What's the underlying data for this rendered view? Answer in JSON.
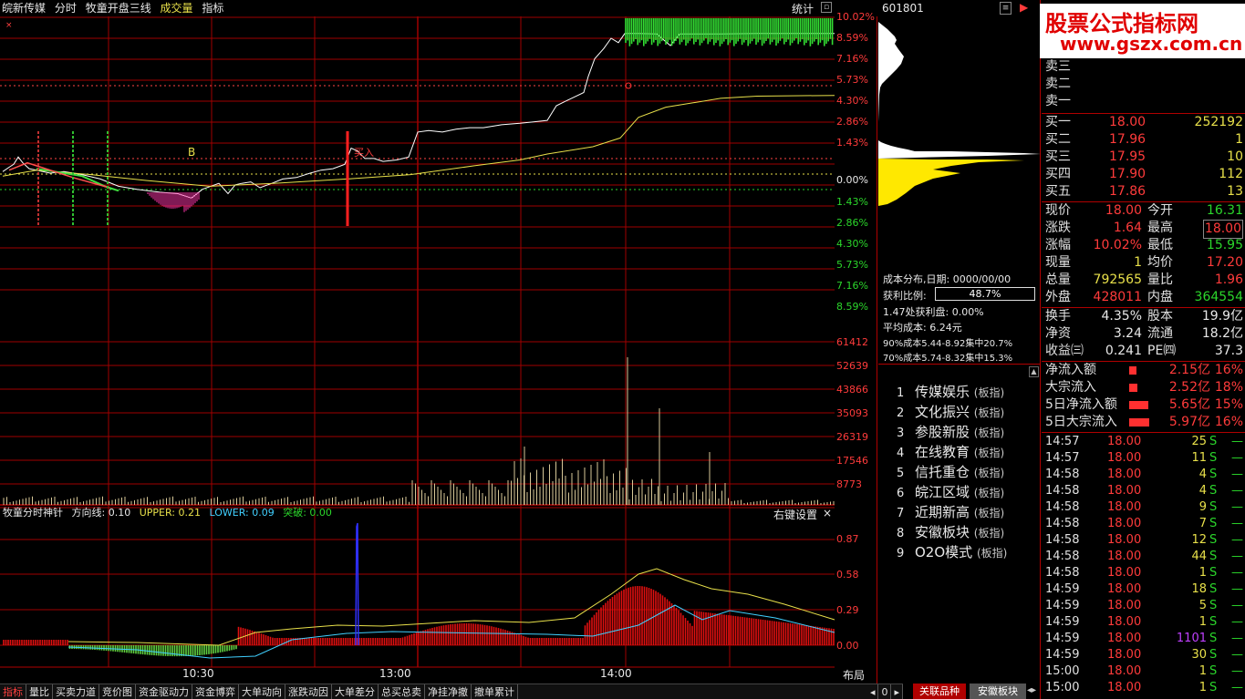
{
  "topbar": {
    "stock_name": "皖新传媒",
    "mode": "分时",
    "formula": "牧童开盘三线",
    "vol_label": "成交量",
    "indicator": "指标",
    "stats": "统计"
  },
  "price_axis": {
    "up_labels": [
      "10.02%",
      "8.59%",
      "7.16%",
      "5.73%",
      "4.30%",
      "2.86%",
      "1.43%"
    ],
    "zero": "0.00%",
    "down_labels": [
      "1.43%",
      "2.86%",
      "4.30%",
      "5.73%",
      "7.16%",
      "8.59%"
    ]
  },
  "volume_axis": [
    "61412",
    "52639",
    "43866",
    "35093",
    "26319",
    "17546",
    "8773"
  ],
  "indicator_axis": [
    "0.87",
    "0.58",
    "0.29",
    "0.00"
  ],
  "time_axis": [
    "10:30",
    "13:00",
    "14:00"
  ],
  "chart_marks": {
    "b_label": "B",
    "buy_label": "买入"
  },
  "indicator_bar": {
    "name": "牧童分时神针",
    "direction": "方向线: 0.10",
    "upper": "UPPER: 0.21",
    "lower": "LOWER: 0.09",
    "breakout": "突破: 0.00",
    "settings": "右键设置",
    "close": "×"
  },
  "bottom_tabs": [
    "指标",
    "量比",
    "买卖力道",
    "竞价图",
    "资金驱动力",
    "资金博弈",
    "大单动向",
    "涨跌动因",
    "大单差分",
    "总买总卖",
    "净挂净撤",
    "撤单累计"
  ],
  "layout_btn": "布局",
  "mid_panel": {
    "code": "601801",
    "cost_title": "成本分布,日期: 0000/00/00",
    "profit_label": "获利比例:",
    "profit_value": "48.7%",
    "profit_at": "1.47处获利盘: 0.00%",
    "avg_cost": "平均成本: 6.24元",
    "cost90": "90%成本5.44-8.92集中20.7%",
    "cost70": "70%成本5.74-8.32集中15.3%",
    "sectors": [
      {
        "n": "1",
        "name": "传媒娱乐",
        "tag": "(板指)"
      },
      {
        "n": "2",
        "name": "文化振兴",
        "tag": "(板指)"
      },
      {
        "n": "3",
        "name": "参股新股",
        "tag": "(板指)"
      },
      {
        "n": "4",
        "name": "在线教育",
        "tag": "(板指)"
      },
      {
        "n": "5",
        "name": "信托重仓",
        "tag": "(板指)"
      },
      {
        "n": "6",
        "name": "皖江区域",
        "tag": "(板指)"
      },
      {
        "n": "7",
        "name": "近期新高",
        "tag": "(板指)"
      },
      {
        "n": "8",
        "name": "安徽板块",
        "tag": "(板指)"
      },
      {
        "n": "9",
        "name": "O2O模式",
        "tag": "(板指)"
      }
    ],
    "tab_related": "关联品种",
    "tab_anhui": "安徽板块"
  },
  "watermark": {
    "line1": "股票公式指标网",
    "line2": "www.gszx.com.cn"
  },
  "quote": {
    "sells": [
      {
        "label": "卖三",
        "price": "",
        "vol": ""
      },
      {
        "label": "卖二",
        "price": "",
        "vol": ""
      },
      {
        "label": "卖一",
        "price": "",
        "vol": ""
      }
    ],
    "buys": [
      {
        "label": "买一",
        "price": "18.00",
        "vol": "252192"
      },
      {
        "label": "买二",
        "price": "17.96",
        "vol": "1"
      },
      {
        "label": "买三",
        "price": "17.95",
        "vol": "10"
      },
      {
        "label": "买四",
        "price": "17.90",
        "vol": "112"
      },
      {
        "label": "买五",
        "price": "17.86",
        "vol": "13"
      }
    ],
    "stats": [
      {
        "l1": "现价",
        "v1": "18.00",
        "c1": "red",
        "l2": "今开",
        "v2": "16.31",
        "c2": "green"
      },
      {
        "l1": "涨跌",
        "v1": "1.64",
        "c1": "red",
        "l2": "最高",
        "v2": "18.00",
        "c2": "red"
      },
      {
        "l1": "涨幅",
        "v1": "10.02%",
        "c1": "red",
        "l2": "最低",
        "v2": "15.95",
        "c2": "green"
      },
      {
        "l1": "现量",
        "v1": "1",
        "c1": "yellow",
        "l2": "均价",
        "v2": "17.20",
        "c2": "red"
      },
      {
        "l1": "总量",
        "v1": "792565",
        "c1": "yellow",
        "l2": "量比",
        "v2": "1.96",
        "c2": "red"
      },
      {
        "l1": "外盘",
        "v1": "428011",
        "c1": "red",
        "l2": "内盘",
        "v2": "364554",
        "c2": "green"
      }
    ],
    "stats2": [
      {
        "l1": "换手",
        "v1": "4.35%",
        "c1": "white",
        "l2": "股本",
        "v2": "19.9亿",
        "c2": "white"
      },
      {
        "l1": "净资",
        "v1": "3.24",
        "c1": "white",
        "l2": "流通",
        "v2": "18.2亿",
        "c2": "white"
      },
      {
        "l1": "收益㈢",
        "v1": "0.241",
        "c1": "white",
        "l2": "PE㈣",
        "v2": "37.3",
        "c2": "white"
      }
    ],
    "flows": [
      {
        "label": "净流入额",
        "amount": "2.15亿",
        "pct": "16%",
        "bar": 0.36
      },
      {
        "label": "大宗流入",
        "amount": "2.52亿",
        "pct": "18%",
        "bar": 0.42
      },
      {
        "label": "5日净流入额",
        "amount": "5.65亿",
        "pct": "15%",
        "bar": 0.95
      },
      {
        "label": "5日大宗流入",
        "amount": "5.97亿",
        "pct": "16%",
        "bar": 1.0
      }
    ],
    "ticks": [
      {
        "t": "14:57",
        "p": "18.00",
        "q": "25",
        "qc": "yellow",
        "s": "S"
      },
      {
        "t": "14:57",
        "p": "18.00",
        "q": "11",
        "qc": "yellow",
        "s": "S"
      },
      {
        "t": "14:58",
        "p": "18.00",
        "q": "4",
        "qc": "yellow",
        "s": "S"
      },
      {
        "t": "14:58",
        "p": "18.00",
        "q": "4",
        "qc": "yellow",
        "s": "S"
      },
      {
        "t": "14:58",
        "p": "18.00",
        "q": "9",
        "qc": "yellow",
        "s": "S"
      },
      {
        "t": "14:58",
        "p": "18.00",
        "q": "7",
        "qc": "yellow",
        "s": "S"
      },
      {
        "t": "14:58",
        "p": "18.00",
        "q": "12",
        "qc": "yellow",
        "s": "S"
      },
      {
        "t": "14:58",
        "p": "18.00",
        "q": "44",
        "qc": "yellow",
        "s": "S"
      },
      {
        "t": "14:58",
        "p": "18.00",
        "q": "1",
        "qc": "yellow",
        "s": "S"
      },
      {
        "t": "14:59",
        "p": "18.00",
        "q": "18",
        "qc": "yellow",
        "s": "S"
      },
      {
        "t": "14:59",
        "p": "18.00",
        "q": "5",
        "qc": "yellow",
        "s": "S"
      },
      {
        "t": "14:59",
        "p": "18.00",
        "q": "1",
        "qc": "yellow",
        "s": "S"
      },
      {
        "t": "14:59",
        "p": "18.00",
        "q": "1101",
        "qc": "purple",
        "s": "S"
      },
      {
        "t": "14:59",
        "p": "18.00",
        "q": "30",
        "qc": "yellow",
        "s": "S"
      },
      {
        "t": "15:00",
        "p": "18.00",
        "q": "1",
        "qc": "yellow",
        "s": "S"
      },
      {
        "t": "15:00",
        "p": "18.00",
        "q": "1",
        "qc": "yellow",
        "s": "S"
      }
    ]
  },
  "colors": {
    "up": "#ff3b3b",
    "down": "#2bd62b",
    "grid": "#a00000",
    "price_line": "#ffffff",
    "avg_line": "#e8e04a",
    "pink": "#ff33aa",
    "blue": "#3030ff"
  }
}
